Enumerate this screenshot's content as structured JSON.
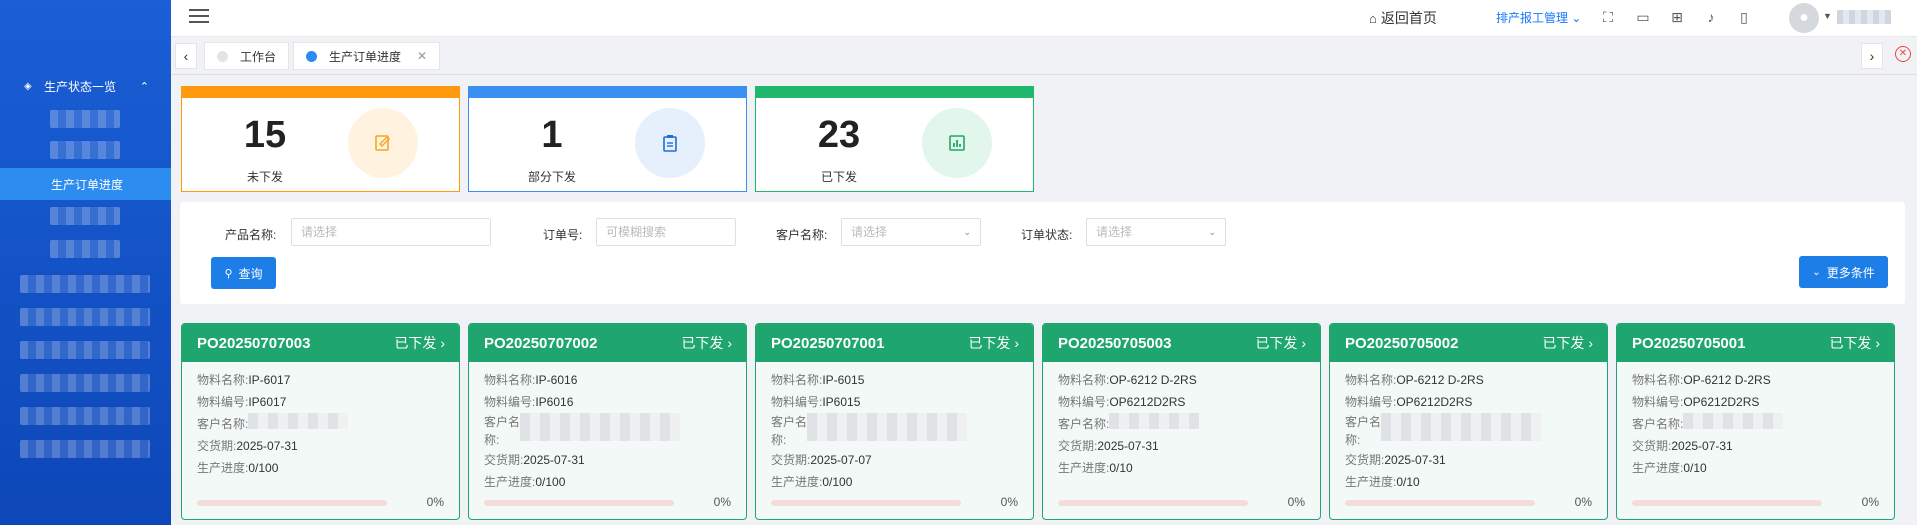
{
  "sidebar": {
    "group_label": "生产状态一览",
    "active_item": "生产订单进度"
  },
  "header": {
    "home_label": "返回首页",
    "menu_label": "排产报工管理",
    "icons": [
      "fullscreen-icon",
      "monitor-icon",
      "layout-icon",
      "bell-icon",
      "mobile-icon"
    ]
  },
  "tabs": [
    {
      "label": "工作台",
      "active": false
    },
    {
      "label": "生产订单进度",
      "active": true
    }
  ],
  "stats": [
    {
      "value": "15",
      "label": "未下发",
      "color": "#ff9a0e",
      "icon": "edit-icon"
    },
    {
      "value": "1",
      "label": "部分下发",
      "color": "#3b8ff0",
      "icon": "clipboard-icon"
    },
    {
      "value": "23",
      "label": "已下发",
      "color": "#1fb86c",
      "icon": "chart-icon"
    }
  ],
  "filters": {
    "product_label": "产品名称:",
    "product_placeholder": "请选择",
    "order_label": "订单号:",
    "order_placeholder": "可模糊搜索",
    "customer_label": "客户名称:",
    "customer_placeholder": "请选择",
    "status_label": "订单状态:",
    "status_placeholder": "请选择",
    "query_label": "查询",
    "more_label": "更多条件"
  },
  "cards": [
    {
      "po": "PO20250707003",
      "status": "已下发",
      "material_name": "IP-6017",
      "material_code": "IP6017",
      "delivery": "2025-07-31",
      "progress": "0/100",
      "pct": "0%"
    },
    {
      "po": "PO20250707002",
      "status": "已下发",
      "material_name": "IP-6016",
      "material_code": "IP6016",
      "delivery": "2025-07-31",
      "progress": "0/100",
      "pct": "0%"
    },
    {
      "po": "PO20250707001",
      "status": "已下发",
      "material_name": "IP-6015",
      "material_code": "IP6015",
      "delivery": "2025-07-07",
      "progress": "0/100",
      "pct": "0%"
    },
    {
      "po": "PO20250705003",
      "status": "已下发",
      "material_name": "OP-6212 D-2RS",
      "material_code": "OP6212D2RS",
      "delivery": "2025-07-31",
      "progress": "0/10",
      "pct": "0%"
    },
    {
      "po": "PO20250705002",
      "status": "已下发",
      "material_name": "OP-6212 D-2RS",
      "material_code": "OP6212D2RS",
      "delivery": "2025-07-31",
      "progress": "0/10",
      "pct": "0%"
    },
    {
      "po": "PO20250705001",
      "status": "已下发",
      "material_name": "OP-6212 D-2RS",
      "material_code": "OP6212D2RS",
      "delivery": "2025-07-31",
      "progress": "0/10",
      "pct": "0%"
    }
  ],
  "card_labels": {
    "material_name": "物料名称:",
    "material_code": "物料编号:",
    "customer": "客户名称:",
    "delivery": "交货期:",
    "progress": "生产进度:"
  }
}
